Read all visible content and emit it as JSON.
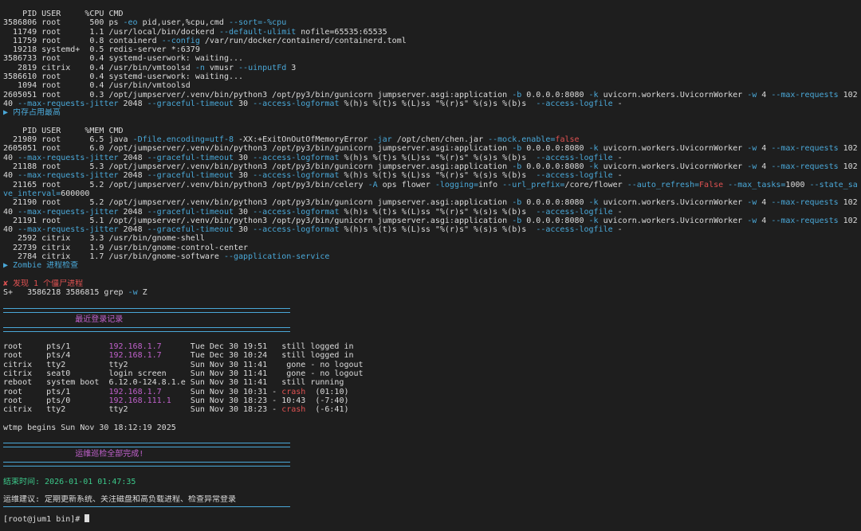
{
  "cpu_section": {
    "header": "    PID USER     %CPU CMD",
    "rows": [
      [
        {
          "t": "3586806 root      500 ps ",
          "c": "w"
        },
        {
          "t": "-eo",
          "c": "b"
        },
        {
          "t": " pid,user,%cpu,cmd ",
          "c": "w"
        },
        {
          "t": "--sort=-%cpu",
          "c": "b"
        }
      ],
      [
        {
          "t": "  11749 root      1.1 /usr/local/bin/dockerd ",
          "c": "w"
        },
        {
          "t": "--default-ulimit",
          "c": "b"
        },
        {
          "t": " nofile=65535:65535",
          "c": "w"
        }
      ],
      [
        {
          "t": "  11759 root      0.8 containerd ",
          "c": "w"
        },
        {
          "t": "--config",
          "c": "b"
        },
        {
          "t": " /var/run/docker/containerd/containerd.toml",
          "c": "w"
        }
      ],
      [
        {
          "t": "  19218 systemd+  0.5 redis-server *:6379",
          "c": "w"
        }
      ],
      [
        {
          "t": "3586733 root      0.4 systemd-userwork: waiting...",
          "c": "w"
        }
      ],
      [
        {
          "t": "   2819 citrix    0.4 /usr/bin/vmtoolsd ",
          "c": "w"
        },
        {
          "t": "-n",
          "c": "b"
        },
        {
          "t": " vmusr ",
          "c": "w"
        },
        {
          "t": "--uinputFd",
          "c": "b"
        },
        {
          "t": " 3",
          "c": "w"
        }
      ],
      [
        {
          "t": "3586610 root      0.4 systemd-userwork: waiting...",
          "c": "w"
        }
      ],
      [
        {
          "t": "   1094 root      0.4 /usr/bin/vmtoolsd",
          "c": "w"
        }
      ],
      [
        {
          "t": "2605051 root      0.3 /opt/jumpserver/.venv/bin/python3 /opt/py3/bin/gunicorn jumpserver.asgi:application ",
          "c": "w"
        },
        {
          "t": "-b",
          "c": "b"
        },
        {
          "t": " 0.0.0.0:8080 ",
          "c": "w"
        },
        {
          "t": "-k",
          "c": "b"
        },
        {
          "t": " uvicorn.workers.UvicornWorker ",
          "c": "w"
        },
        {
          "t": "-w",
          "c": "b"
        },
        {
          "t": " 4 ",
          "c": "w"
        },
        {
          "t": "--max-requests",
          "c": "b"
        },
        {
          "t": " 102",
          "c": "w"
        }
      ],
      [
        {
          "t": "40 ",
          "c": "w"
        },
        {
          "t": "--max-requests-jitter",
          "c": "b"
        },
        {
          "t": " 2048 ",
          "c": "w"
        },
        {
          "t": "--graceful-timeout",
          "c": "b"
        },
        {
          "t": " 30 ",
          "c": "w"
        },
        {
          "t": "--access-logformat",
          "c": "b"
        },
        {
          "t": " %(h)s %(t)s %(L)ss \"%(r)s\" %(s)s %(b)s  ",
          "c": "w"
        },
        {
          "t": "--access-logfile",
          "c": "b"
        },
        {
          "t": " -",
          "c": "w"
        }
      ]
    ]
  },
  "mem_title": "▶ 内存占用最高",
  "mem_section": {
    "header": "    PID USER     %MEM CMD",
    "rows": [
      [
        {
          "t": "  21989 root      6.5 java ",
          "c": "w"
        },
        {
          "t": "-Dfile.encoding=utf-8",
          "c": "b"
        },
        {
          "t": " -XX:+ExitOnOutOfMemoryError ",
          "c": "w"
        },
        {
          "t": "-jar",
          "c": "b"
        },
        {
          "t": " /opt/chen/chen.jar ",
          "c": "w"
        },
        {
          "t": "--mock.enable=",
          "c": "b"
        },
        {
          "t": "false",
          "c": "r"
        }
      ],
      [
        {
          "t": "2605051 root      6.0 /opt/jumpserver/.venv/bin/python3 /opt/py3/bin/gunicorn jumpserver.asgi:application ",
          "c": "w"
        },
        {
          "t": "-b",
          "c": "b"
        },
        {
          "t": " 0.0.0.0:8080 ",
          "c": "w"
        },
        {
          "t": "-k",
          "c": "b"
        },
        {
          "t": " uvicorn.workers.UvicornWorker ",
          "c": "w"
        },
        {
          "t": "-w",
          "c": "b"
        },
        {
          "t": " 4 ",
          "c": "w"
        },
        {
          "t": "--max-requests",
          "c": "b"
        },
        {
          "t": " 102",
          "c": "w"
        }
      ],
      [
        {
          "t": "40 ",
          "c": "w"
        },
        {
          "t": "--max-requests-jitter",
          "c": "b"
        },
        {
          "t": " 2048 ",
          "c": "w"
        },
        {
          "t": "--graceful-timeout",
          "c": "b"
        },
        {
          "t": " 30 ",
          "c": "w"
        },
        {
          "t": "--access-logformat",
          "c": "b"
        },
        {
          "t": " %(h)s %(t)s %(L)ss \"%(r)s\" %(s)s %(b)s  ",
          "c": "w"
        },
        {
          "t": "--access-logfile",
          "c": "b"
        },
        {
          "t": " -",
          "c": "w"
        }
      ],
      [
        {
          "t": "  21188 root      5.3 /opt/jumpserver/.venv/bin/python3 /opt/py3/bin/gunicorn jumpserver.asgi:application ",
          "c": "w"
        },
        {
          "t": "-b",
          "c": "b"
        },
        {
          "t": " 0.0.0.0:8080 ",
          "c": "w"
        },
        {
          "t": "-k",
          "c": "b"
        },
        {
          "t": " uvicorn.workers.UvicornWorker ",
          "c": "w"
        },
        {
          "t": "-w",
          "c": "b"
        },
        {
          "t": " 4 ",
          "c": "w"
        },
        {
          "t": "--max-requests",
          "c": "b"
        },
        {
          "t": " 102",
          "c": "w"
        }
      ],
      [
        {
          "t": "40 ",
          "c": "w"
        },
        {
          "t": "--max-requests-jitter",
          "c": "b"
        },
        {
          "t": " 2048 ",
          "c": "w"
        },
        {
          "t": "--graceful-timeout",
          "c": "b"
        },
        {
          "t": " 30 ",
          "c": "w"
        },
        {
          "t": "--access-logformat",
          "c": "b"
        },
        {
          "t": " %(h)s %(t)s %(L)ss \"%(r)s\" %(s)s %(b)s  ",
          "c": "w"
        },
        {
          "t": "--access-logfile",
          "c": "b"
        },
        {
          "t": " -",
          "c": "w"
        }
      ],
      [
        {
          "t": "  21165 root      5.2 /opt/jumpserver/.venv/bin/python3 /opt/py3/bin/celery ",
          "c": "w"
        },
        {
          "t": "-A",
          "c": "b"
        },
        {
          "t": " ops flower ",
          "c": "w"
        },
        {
          "t": "-logging=",
          "c": "b"
        },
        {
          "t": "info ",
          "c": "w"
        },
        {
          "t": "--url_prefix=",
          "c": "b"
        },
        {
          "t": "/core/flower ",
          "c": "w"
        },
        {
          "t": "--auto_refresh=",
          "c": "b"
        },
        {
          "t": "False",
          "c": "r"
        },
        {
          "t": " ",
          "c": "w"
        },
        {
          "t": "--max_tasks=",
          "c": "b"
        },
        {
          "t": "1000 ",
          "c": "w"
        },
        {
          "t": "--state_sa",
          "c": "b"
        }
      ],
      [
        {
          "t": "ve_interval=",
          "c": "b"
        },
        {
          "t": "600000",
          "c": "w"
        }
      ],
      [
        {
          "t": "  21190 root      5.2 /opt/jumpserver/.venv/bin/python3 /opt/py3/bin/gunicorn jumpserver.asgi:application ",
          "c": "w"
        },
        {
          "t": "-b",
          "c": "b"
        },
        {
          "t": " 0.0.0.0:8080 ",
          "c": "w"
        },
        {
          "t": "-k",
          "c": "b"
        },
        {
          "t": " uvicorn.workers.UvicornWorker ",
          "c": "w"
        },
        {
          "t": "-w",
          "c": "b"
        },
        {
          "t": " 4 ",
          "c": "w"
        },
        {
          "t": "--max-requests",
          "c": "b"
        },
        {
          "t": " 102",
          "c": "w"
        }
      ],
      [
        {
          "t": "40 ",
          "c": "w"
        },
        {
          "t": "--max-requests-jitter",
          "c": "b"
        },
        {
          "t": " 2048 ",
          "c": "w"
        },
        {
          "t": "--graceful-timeout",
          "c": "b"
        },
        {
          "t": " 30 ",
          "c": "w"
        },
        {
          "t": "--access-logformat",
          "c": "b"
        },
        {
          "t": " %(h)s %(t)s %(L)ss \"%(r)s\" %(s)s %(b)s  ",
          "c": "w"
        },
        {
          "t": "--access-logfile",
          "c": "b"
        },
        {
          "t": " -",
          "c": "w"
        }
      ],
      [
        {
          "t": "  21191 root      5.1 /opt/jumpserver/.venv/bin/python3 /opt/py3/bin/gunicorn jumpserver.asgi:application ",
          "c": "w"
        },
        {
          "t": "-b",
          "c": "b"
        },
        {
          "t": " 0.0.0.0:8080 ",
          "c": "w"
        },
        {
          "t": "-k",
          "c": "b"
        },
        {
          "t": " uvicorn.workers.UvicornWorker ",
          "c": "w"
        },
        {
          "t": "-w",
          "c": "b"
        },
        {
          "t": " 4 ",
          "c": "w"
        },
        {
          "t": "--max-requests",
          "c": "b"
        },
        {
          "t": " 102",
          "c": "w"
        }
      ],
      [
        {
          "t": "40 ",
          "c": "w"
        },
        {
          "t": "--max-requests-jitter",
          "c": "b"
        },
        {
          "t": " 2048 ",
          "c": "w"
        },
        {
          "t": "--graceful-timeout",
          "c": "b"
        },
        {
          "t": " 30 ",
          "c": "w"
        },
        {
          "t": "--access-logformat",
          "c": "b"
        },
        {
          "t": " %(h)s %(t)s %(L)ss \"%(r)s\" %(s)s %(b)s  ",
          "c": "w"
        },
        {
          "t": "--access-logfile",
          "c": "b"
        },
        {
          "t": " -",
          "c": "w"
        }
      ],
      [
        {
          "t": "   2592 citrix    3.3 /usr/bin/gnome-shell",
          "c": "w"
        }
      ],
      [
        {
          "t": "  22739 citrix    1.9 /usr/bin/gnome-control-center",
          "c": "w"
        }
      ],
      [
        {
          "t": "   2784 citrix    1.7 /usr/bin/gnome-software ",
          "c": "w"
        },
        {
          "t": "--gapplication-service",
          "c": "b"
        }
      ]
    ]
  },
  "zombie_title": "▶ Zombie 进程检查",
  "zombie_found": "✘ 发现 1 个僵尸进程",
  "zombie_line": [
    {
      "t": "S+   3586218 3586815 grep ",
      "c": "w"
    },
    {
      "t": "-w",
      "c": "b"
    },
    {
      "t": " Z",
      "c": "w"
    }
  ],
  "login_banner": "               最近登录记录",
  "login_rows": [
    [
      {
        "t": "root     pts/1        ",
        "c": "w"
      },
      {
        "t": "192.168.1.7",
        "c": "m"
      },
      {
        "t": "      Tue Dec 30 19:51   still logged in",
        "c": "w"
      }
    ],
    [
      {
        "t": "root     pts/4        ",
        "c": "w"
      },
      {
        "t": "192.168.1.7",
        "c": "m"
      },
      {
        "t": "      Tue Dec 30 10:24   still logged in",
        "c": "w"
      }
    ],
    [
      {
        "t": "citrix   tty2         tty2             Sun Nov 30 11:41    gone - no logout",
        "c": "w"
      }
    ],
    [
      {
        "t": "citrix   seat0        login screen     Sun Nov 30 11:41    gone - no logout",
        "c": "w"
      }
    ],
    [
      {
        "t": "reboot   system boot  6.12.0-124.8.1.e Sun Nov 30 11:41   still running",
        "c": "w"
      }
    ],
    [
      {
        "t": "root     pts/1        ",
        "c": "w"
      },
      {
        "t": "192.168.1.7",
        "c": "m"
      },
      {
        "t": "      Sun Nov 30 10:31 - ",
        "c": "w"
      },
      {
        "t": "crash",
        "c": "r"
      },
      {
        "t": "  (01:10)",
        "c": "w"
      }
    ],
    [
      {
        "t": "root     pts/0        ",
        "c": "w"
      },
      {
        "t": "192.168.111.1",
        "c": "m"
      },
      {
        "t": "    Sun Nov 30 18:23 - 10:43  (-7:40)",
        "c": "w"
      }
    ],
    [
      {
        "t": "citrix   tty2         tty2             Sun Nov 30 18:23 - ",
        "c": "w"
      },
      {
        "t": "crash",
        "c": "r"
      },
      {
        "t": "  (-6:41)",
        "c": "w"
      }
    ]
  ],
  "wtmp_line": "wtmp begins Sun Nov 30 18:12:19 2025",
  "done_banner": "               运维巡检全部完成!",
  "end_time": "结束时间: 2026-01-01 01:47:35",
  "advice": "运维建议: 定期更新系统、关注磁盘和高负载进程、检查异常登录",
  "prompt": "[root@jum1 bin]# "
}
